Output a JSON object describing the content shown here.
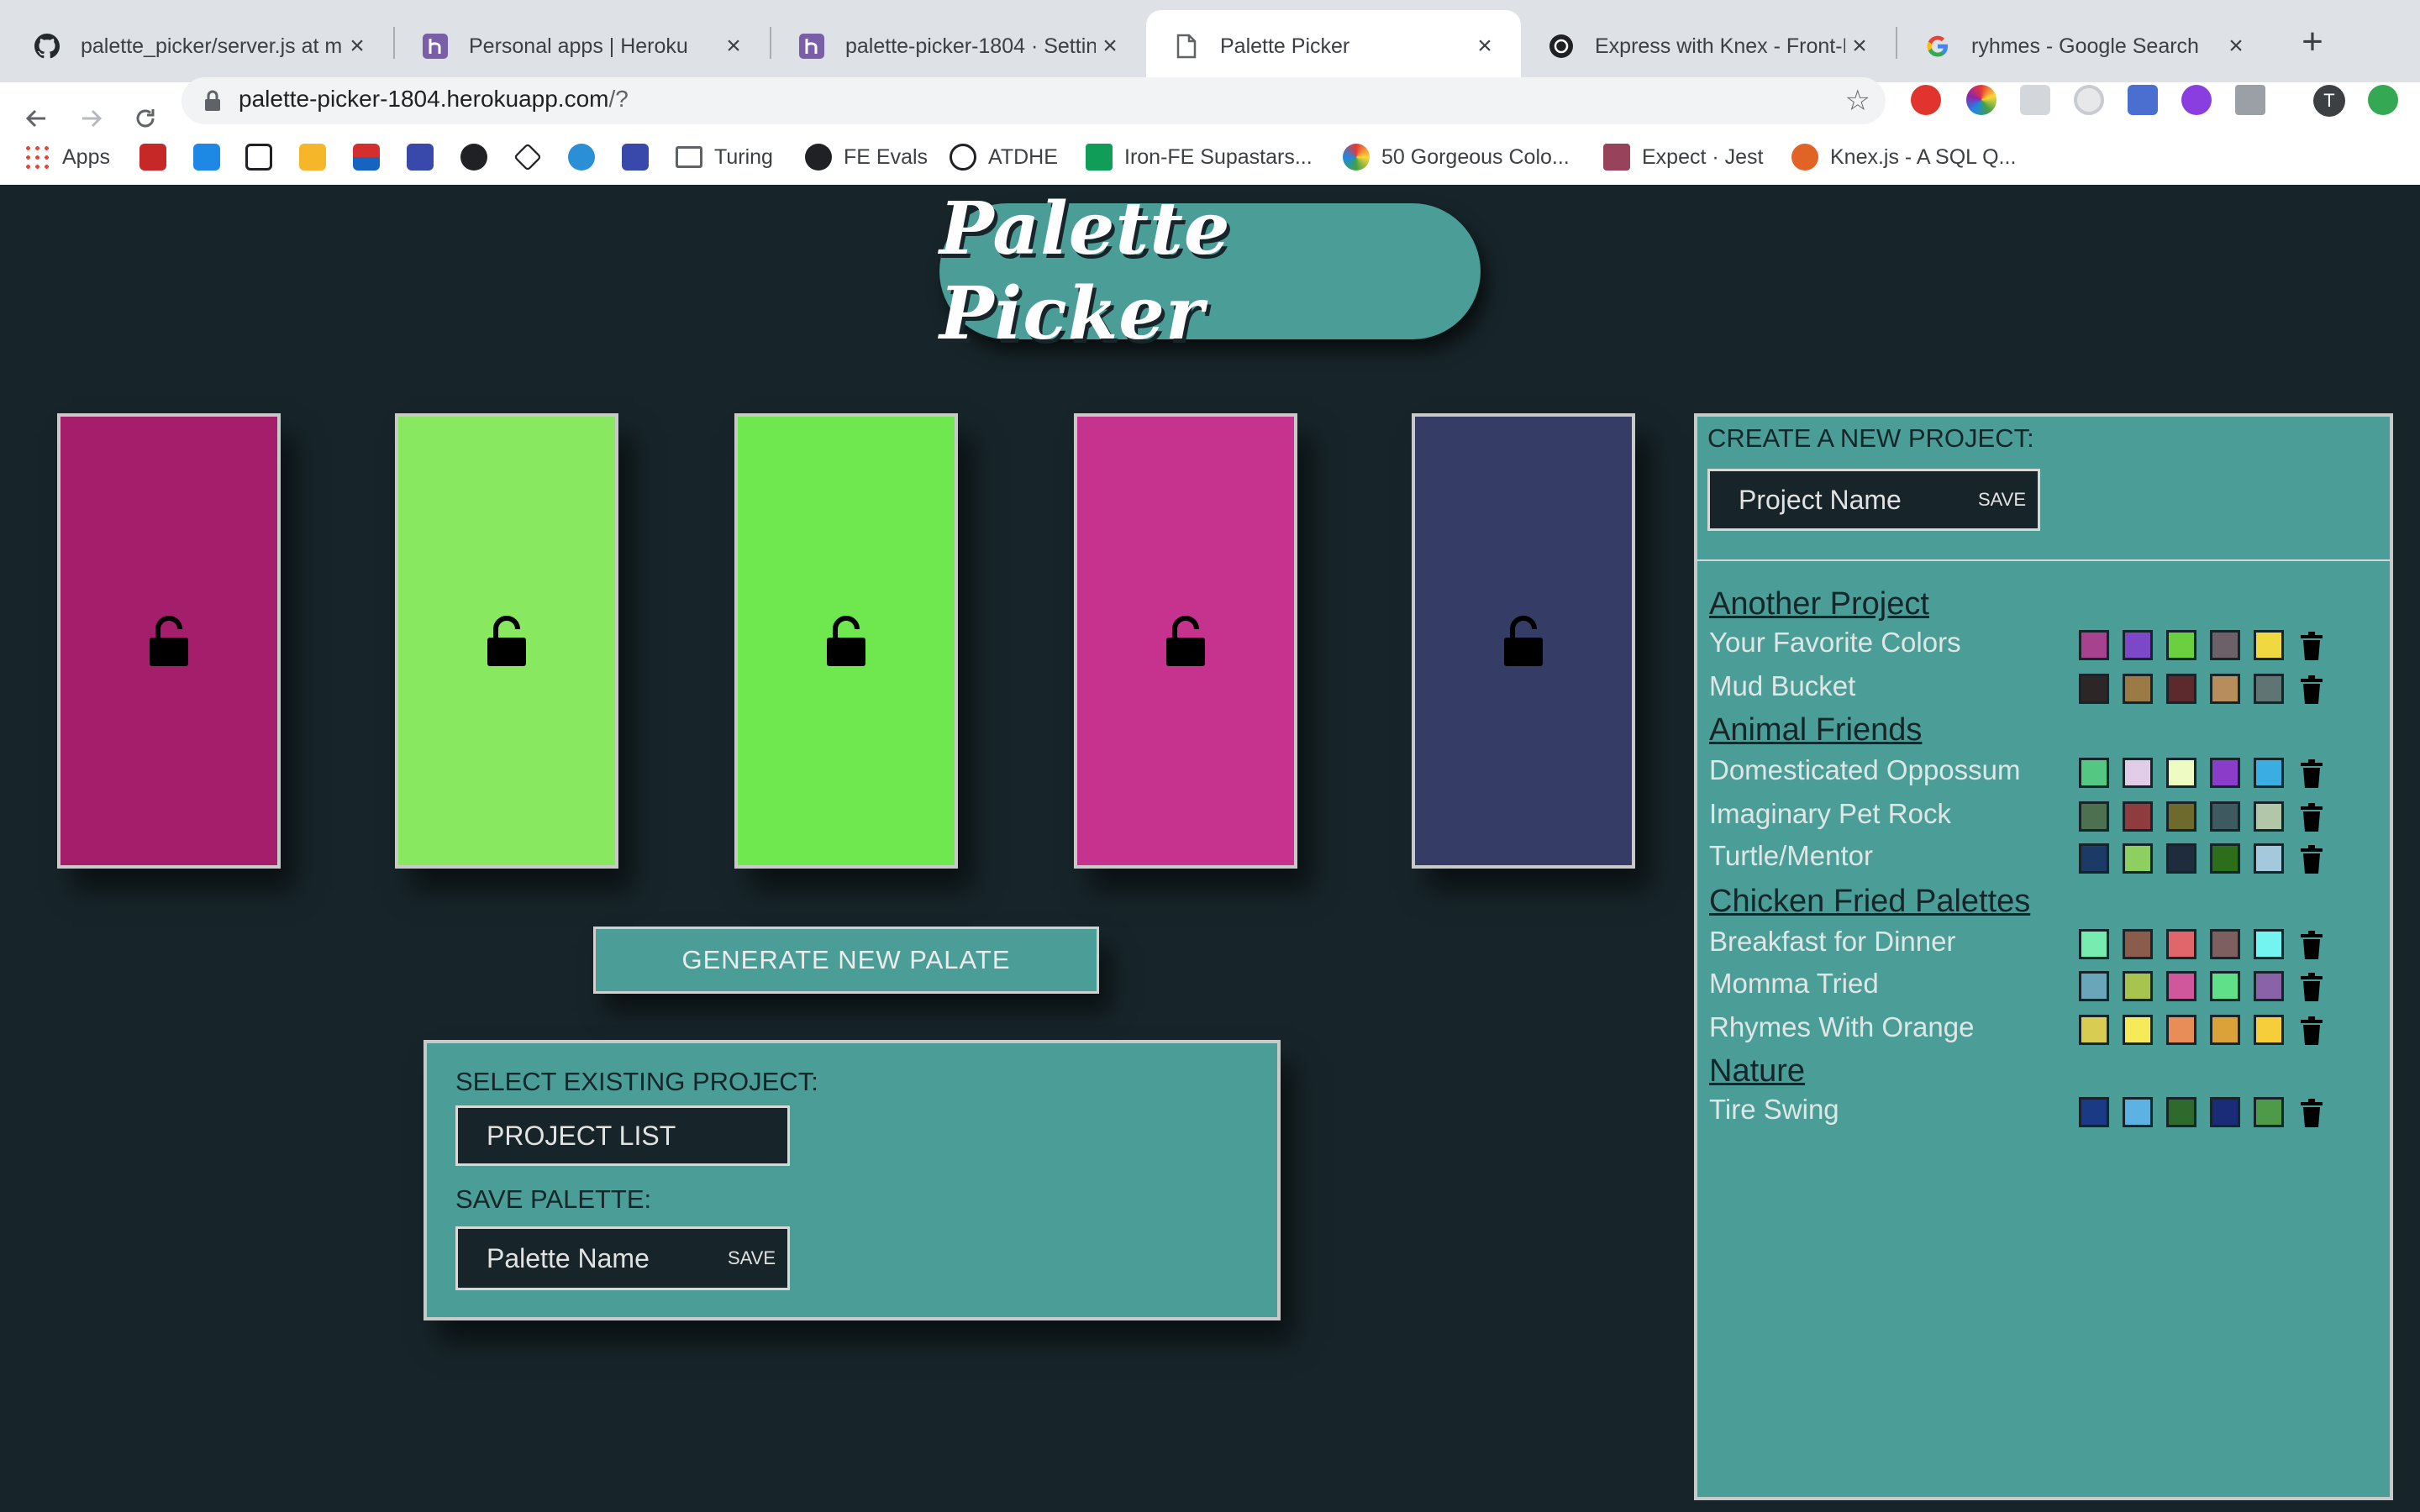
{
  "browser": {
    "tabs": [
      {
        "title": "palette_picker/server.js at m",
        "icon": "github-icon"
      },
      {
        "title": "Personal apps | Heroku",
        "icon": "heroku-icon"
      },
      {
        "title": "palette-picker-1804 · Settin",
        "icon": "heroku-icon"
      },
      {
        "title": "Palette Picker",
        "icon": "document-icon"
      },
      {
        "title": "Express with Knex - Front-E",
        "icon": "turing-icon"
      },
      {
        "title": "ryhmes - Google Search",
        "icon": "google-icon"
      }
    ],
    "url_host": "palette-picker-1804.herokuapp.com",
    "url_path": "/?",
    "profile_initial": "T",
    "bookmarks": [
      {
        "label": "Apps"
      },
      {
        "label": "Turing"
      },
      {
        "label": "FE Evals"
      },
      {
        "label": "ATDHE"
      },
      {
        "label": "Iron-FE Supastars..."
      },
      {
        "label": "50 Gorgeous Colo..."
      },
      {
        "label": "Expect · Jest"
      },
      {
        "label": "Knex.js - A SQL Q..."
      }
    ]
  },
  "app": {
    "logo_text": "Palette Picker",
    "theme": {
      "background": "#17252a",
      "panel": "#4a9e97"
    },
    "current_palette": [
      {
        "color": "#a41e6c",
        "locked": false
      },
      {
        "color": "#88e961",
        "locked": false
      },
      {
        "color": "#6ee84e",
        "locked": false
      },
      {
        "color": "#c5338e",
        "locked": false
      },
      {
        "color": "#353c66",
        "locked": false
      }
    ],
    "generate_label": "GENERATE NEW PALATE",
    "save_panel": {
      "select_label": "SELECT EXISTING PROJECT:",
      "project_select_value": "PROJECT LIST",
      "save_label": "SAVE PALETTE:",
      "palette_name_placeholder": "Palette Name",
      "save_button": "SAVE"
    },
    "projects_panel": {
      "create_label": "CREATE A NEW PROJECT:",
      "project_name_placeholder": "Project Name",
      "save_button": "SAVE",
      "projects": [
        {
          "name": "Another Project",
          "palettes": [
            {
              "name": "Your Favorite Colors",
              "colors": [
                "#a6428e",
                "#7d48c8",
                "#6ad040",
                "#6c6069",
                "#f0d840"
              ]
            },
            {
              "name": "Mud Bucket",
              "colors": [
                "#2c2627",
                "#9b7a45",
                "#5c2a2c",
                "#b88d5c",
                "#5e7573"
              ]
            }
          ]
        },
        {
          "name": "Animal Friends",
          "palettes": [
            {
              "name": "Domesticated Oppossum",
              "colors": [
                "#54c882",
                "#e2cde8",
                "#eefcc4",
                "#8b3cc8",
                "#3aaee0"
              ]
            },
            {
              "name": "Imaginary Pet Rock",
              "colors": [
                "#4c7050",
                "#8e3c3e",
                "#6e6a2e",
                "#3e5a60",
                "#b2c6a8"
              ]
            },
            {
              "name": "Turtle/Mentor",
              "colors": [
                "#1c3a66",
                "#8ed060",
                "#1e2c3e",
                "#2c6e1a",
                "#a4c8dc"
              ]
            }
          ]
        },
        {
          "name": "Chicken Fried Palettes",
          "palettes": [
            {
              "name": "Breakfast for Dinner",
              "colors": [
                "#76ecb0",
                "#8a5c4c",
                "#e0666c",
                "#7c5f5e",
                "#74f4f0"
              ]
            },
            {
              "name": "Momma Tried",
              "colors": [
                "#6aa6ba",
                "#a6c44e",
                "#d0579c",
                "#60e088",
                "#8a62a8"
              ]
            },
            {
              "name": "Rhymes With Orange",
              "colors": [
                "#d8cc52",
                "#f6ea5a",
                "#e88c58",
                "#dca23a",
                "#f6ce3a"
              ]
            }
          ]
        },
        {
          "name": "Nature",
          "palettes": [
            {
              "name": "Tire Swing",
              "colors": [
                "#1a3a86",
                "#5cb2e2",
                "#2e6a2c",
                "#1a2c78",
                "#4e9a48"
              ]
            }
          ]
        }
      ]
    }
  }
}
